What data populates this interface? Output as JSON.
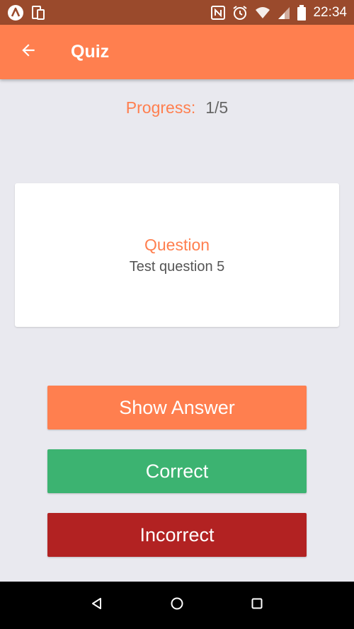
{
  "status_bar": {
    "time": "22:34",
    "background": "#9a4a2c"
  },
  "app_bar": {
    "title": "Quiz",
    "background": "#ff7f4f"
  },
  "progress": {
    "label": "Progress:",
    "value": "1/5"
  },
  "card": {
    "heading": "Question",
    "text": "Test question 5"
  },
  "buttons": {
    "show_answer": "Show Answer",
    "correct": "Correct",
    "incorrect": "Incorrect"
  },
  "colors": {
    "accent": "#ff7f4f",
    "correct": "#3cb371",
    "incorrect": "#b22222",
    "page_background": "#e9e9ef"
  },
  "icons": {
    "status_left": [
      "app-logo-icon",
      "tablet-icon"
    ],
    "status_right": [
      "nfc-icon",
      "alarm-icon",
      "wifi-icon",
      "signal-icon",
      "battery-icon"
    ],
    "app_bar": [
      "back-arrow-icon"
    ],
    "nav": [
      "nav-back-icon",
      "nav-home-icon",
      "nav-recents-icon"
    ]
  }
}
